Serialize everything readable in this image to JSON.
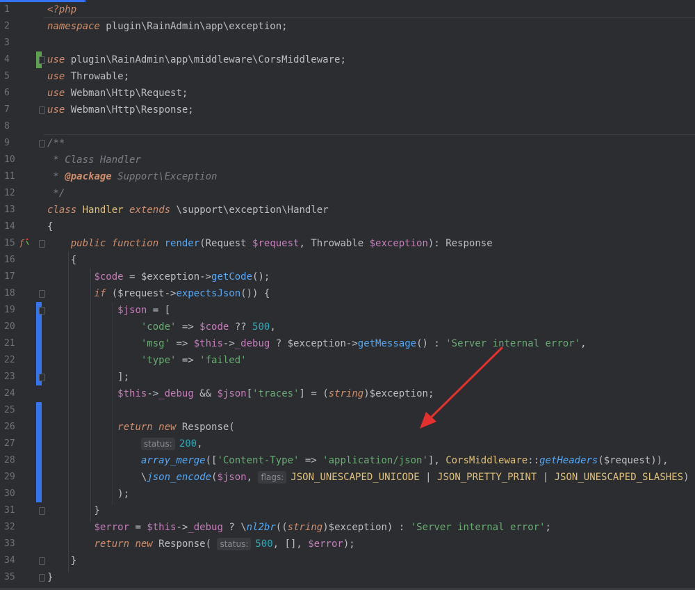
{
  "editor": {
    "language": "php",
    "line_numbers": [
      "1",
      "2",
      "3",
      "4",
      "5",
      "6",
      "7",
      "8",
      "9",
      "10",
      "11",
      "12",
      "13",
      "14",
      "15",
      "16",
      "17",
      "18",
      "19",
      "20",
      "21",
      "22",
      "23",
      "24",
      "25",
      "26",
      "27",
      "28",
      "29",
      "30",
      "31",
      "32",
      "33",
      "34",
      "35"
    ],
    "hints": {
      "status_a": "status:",
      "status_b": "status:",
      "flags": "flags:"
    },
    "gutter_icons": {
      "line15": "implements-method-icon"
    },
    "colors": {
      "background": "#2b2d31",
      "keyword": "#cf8e6d",
      "variable": "#c77dbb",
      "function": "#56a8f5",
      "string": "#6aab73",
      "number": "#2aacb8",
      "comment": "#7a7e85",
      "modified_marker": "#3574f0",
      "added_marker": "#5fa04e",
      "arrow": "#e5312e"
    }
  }
}
